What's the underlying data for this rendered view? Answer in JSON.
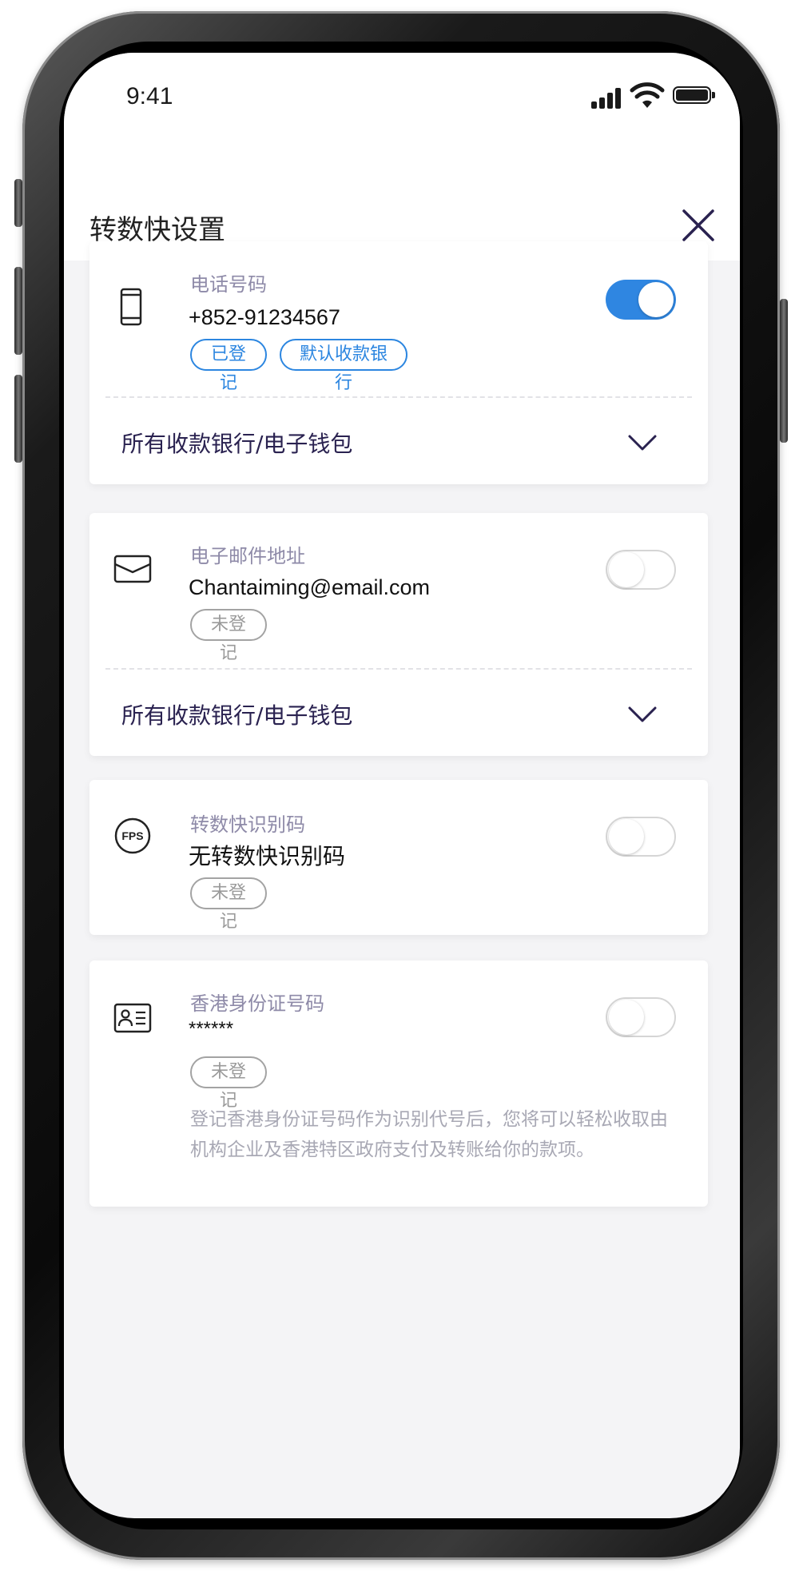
{
  "status_bar": {
    "time": "9:41"
  },
  "header": {
    "title": "转数快设置"
  },
  "cards": [
    {
      "label": "电话号码",
      "value": "+852-91234567",
      "icon": "phone-icon",
      "toggle_on": true,
      "badges": [
        "已登记",
        "默认收款银行"
      ],
      "expand_label": "所有收款银行/电子钱包"
    },
    {
      "label": "电子邮件地址",
      "value": "Chantaiming@email.com",
      "icon": "envelope-icon",
      "toggle_on": false,
      "badges": [
        "未登记"
      ],
      "expand_label": "所有收款银行/电子钱包"
    },
    {
      "label": "转数快识别码",
      "value": "无转数快识别码",
      "icon": "fps-icon",
      "icon_text": "FPS",
      "toggle_on": false,
      "badges": [
        "未登记"
      ]
    },
    {
      "label": "香港身份证号码",
      "value": "******",
      "icon": "id-card-icon",
      "toggle_on": false,
      "badges": [
        "未登记"
      ],
      "note": "登记香港身份证号码作为识别代号后，您将可以轻松收取由机构企业及香港特区政府支付及转账给你的款项。"
    }
  ],
  "colors": {
    "accent_blue": "#2f86e1",
    "title_purple": "#2a2250",
    "label_gray": "#8e8aa8",
    "screen_bg": "#f4f4f6"
  }
}
